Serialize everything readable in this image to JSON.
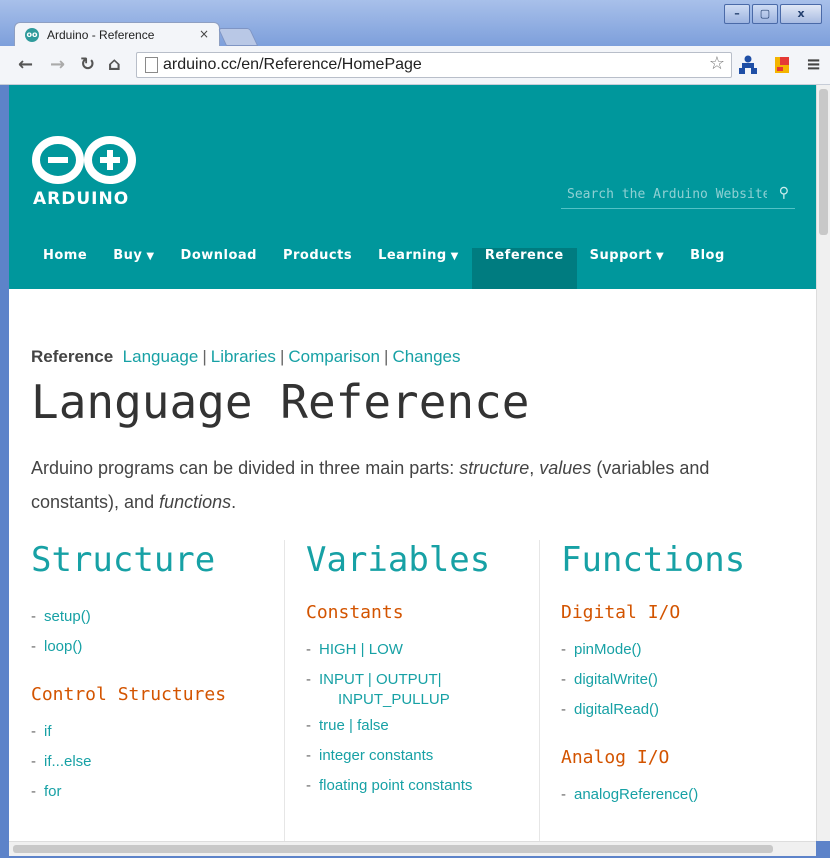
{
  "browser": {
    "tab_title": "Arduino - Reference",
    "tab_close": "×",
    "url": "arduino.cc/en/Reference/HomePage",
    "window_buttons": [
      "–",
      "▢",
      "x"
    ],
    "favicon_text": "oo"
  },
  "header": {
    "logo_text": "ARDUINO",
    "search_placeholder": "Search the Arduino Website",
    "nav": [
      {
        "label": "Home",
        "caret": false
      },
      {
        "label": "Buy",
        "caret": true
      },
      {
        "label": "Download",
        "caret": false
      },
      {
        "label": "Products",
        "caret": false
      },
      {
        "label": "Learning",
        "caret": true
      },
      {
        "label": "Reference",
        "caret": false,
        "active": true
      },
      {
        "label": "Support",
        "caret": true
      },
      {
        "label": "Blog",
        "caret": false
      }
    ],
    "colors": {
      "brand": "#00979c",
      "active_nav": "#007c80"
    }
  },
  "breadcrumb": {
    "current": "Reference",
    "links": [
      "Language",
      "Libraries",
      "Comparison",
      "Changes"
    ],
    "separator": "|"
  },
  "page": {
    "title": "Language Reference",
    "intro_1": "Arduino programs can be divided in three main parts: ",
    "intro_structure": "structure",
    "intro_comma": ", ",
    "intro_values": "values",
    "intro_2": " (variables and constants), and ",
    "intro_functions": "functions",
    "intro_end": "."
  },
  "columns": {
    "structure": {
      "title": "Structure",
      "items": [
        "setup()",
        "loop()"
      ],
      "sub_title": "Control Structures",
      "sub_items": [
        "if",
        "if...else",
        "for"
      ]
    },
    "variables": {
      "title": "Variables",
      "sub_title": "Constants",
      "items": [
        "HIGH | LOW",
        "INPUT | OUTPUT|",
        "INPUT_PULLUP",
        "true | false",
        "integer constants",
        "floating point constants"
      ]
    },
    "functions": {
      "title": "Functions",
      "sub_title": "Digital I/O",
      "items": [
        "pinMode()",
        "digitalWrite()",
        "digitalRead()"
      ],
      "sub_title_2": "Analog I/O",
      "items_2": [
        "analogReference()"
      ]
    }
  }
}
